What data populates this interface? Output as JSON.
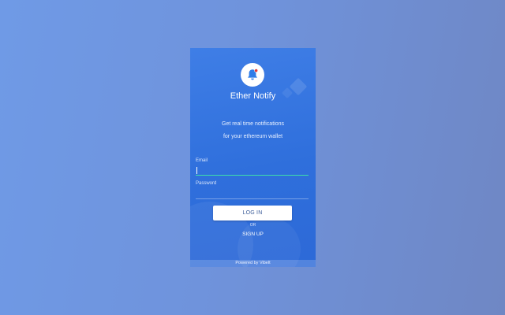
{
  "app": {
    "title": "Ether Notify",
    "logo_icon": "bell-icon",
    "tagline_line1": "Get real time notifications",
    "tagline_line2": "for your ethereum wallet"
  },
  "form": {
    "email_label": "Email",
    "email_value": "",
    "password_label": "Password",
    "password_value": "",
    "login_label": "LOG IN",
    "or_label": "OR",
    "signup_label": "SIGN UP"
  },
  "footer": {
    "text": "Powered by Vibelt"
  },
  "colors": {
    "background": "#6f93dc",
    "panel": "#2f6fdc",
    "accent": "#2f7de8",
    "focus_underline": "#3ee0a8",
    "notification_dot": "#e53935"
  }
}
